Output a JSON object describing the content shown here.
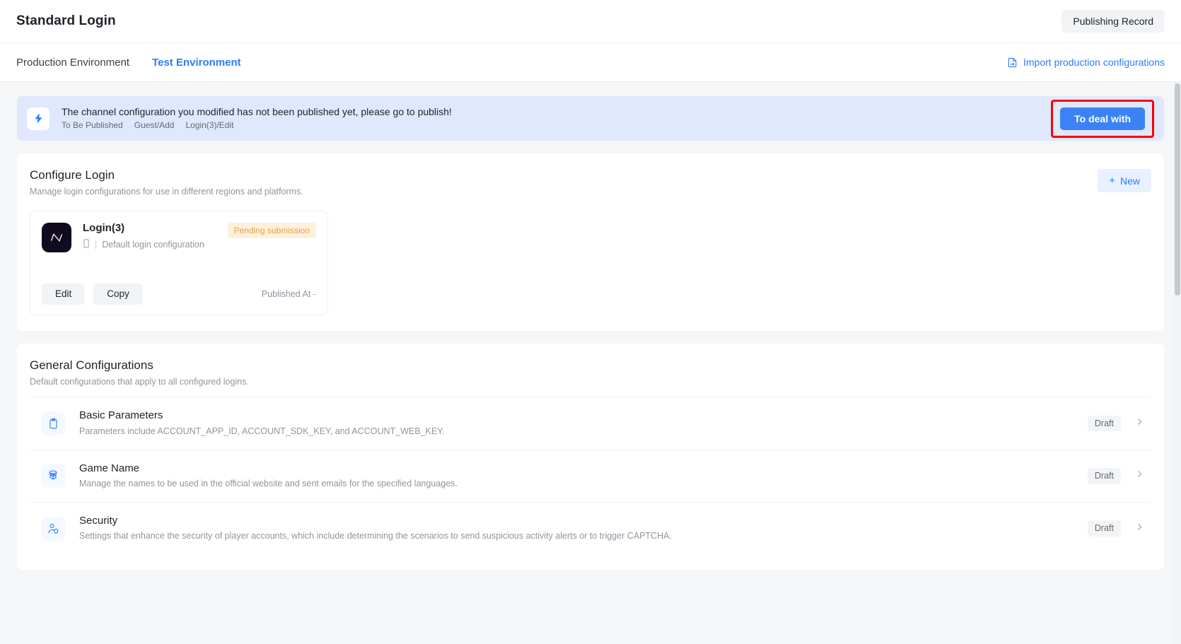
{
  "header": {
    "title": "Standard Login",
    "publishing_record_label": "Publishing Record"
  },
  "tabs": [
    {
      "label": "Production Environment",
      "active": false
    },
    {
      "label": "Test Environment",
      "active": true
    }
  ],
  "import_link": {
    "label": "Import production configurations",
    "icon": "import-icon"
  },
  "alert": {
    "icon": "lightning-bolt-icon",
    "message": "The channel configuration you modified has not been published yet, please go to publish!",
    "meta": [
      "To Be Published",
      "Guest/Add",
      "Login(3)/Edit"
    ],
    "action_label": "To deal with",
    "highlight_color": "#ff0000",
    "background": "#dfe8fd",
    "action_color": "#3b82f6"
  },
  "configure_login": {
    "title": "Configure Login",
    "subtitle": "Manage login configurations for use in different regions and platforms.",
    "new_button": {
      "label": "New",
      "icon": "plus-icon"
    },
    "tiles": [
      {
        "icon": "app-logo-icon",
        "name": "Login(3)",
        "platform_icon": "mobile-icon",
        "divider": "|",
        "description": "Default login configuration",
        "status": "Pending submission",
        "status_color": "#e8a33d",
        "edit_label": "Edit",
        "copy_label": "Copy",
        "published_at": "Published At -"
      }
    ]
  },
  "general_configurations": {
    "title": "General Configurations",
    "subtitle": "Default configurations that apply to all configured logins.",
    "rows": [
      {
        "icon": "clipboard-icon",
        "name": "Basic Parameters",
        "description": "Parameters include ACCOUNT_APP_ID, ACCOUNT_SDK_KEY, and ACCOUNT_WEB_KEY.",
        "status": "Draft",
        "chevron": "chevron-right-icon"
      },
      {
        "icon": "cube-icon",
        "name": "Game Name",
        "description": "Manage the names to be used in the official website and sent emails for the specified languages.",
        "status": "Draft",
        "chevron": "chevron-right-icon"
      },
      {
        "icon": "user-shield-icon",
        "name": "Security",
        "description": "Settings that enhance the security of player accounts, which include determining the scenarios to send suspicious activity alerts or to trigger CAPTCHA.",
        "status": "Draft",
        "chevron": "chevron-right-icon"
      }
    ]
  }
}
